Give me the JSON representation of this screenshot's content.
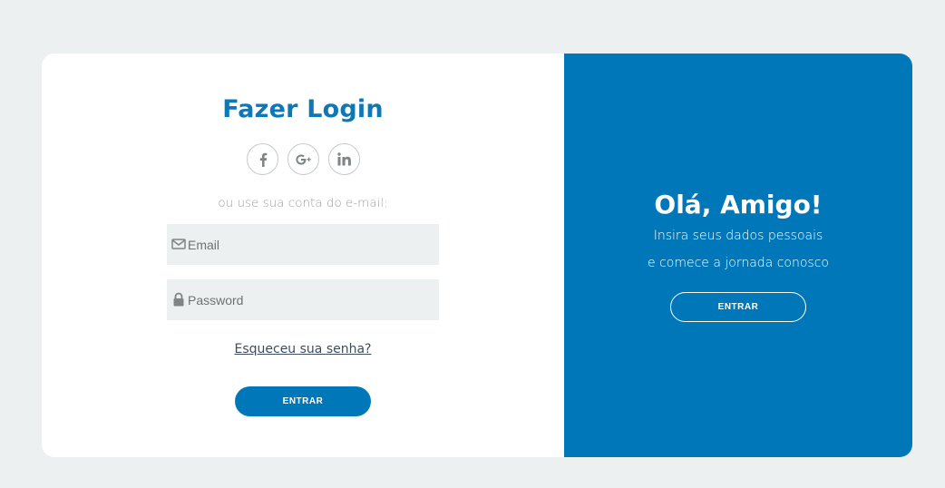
{
  "login": {
    "title": "Fazer Login",
    "social": [
      {
        "icon": "facebook-icon",
        "glyph": "f"
      },
      {
        "icon": "google-plus-icon",
        "glyph": "G+"
      },
      {
        "icon": "linkedin-icon",
        "glyph": "in"
      }
    ],
    "subtitle": "ou use sua conta do e-mail:",
    "email": {
      "value": "",
      "placeholder": "Email",
      "icon": "envelope-icon"
    },
    "password": {
      "value": "",
      "placeholder": "Password",
      "icon": "lock-icon"
    },
    "forgot_label": "Esqueceu sua senha?",
    "submit_label": "ENTRAR"
  },
  "welcome": {
    "title": "Olá, Amigo!",
    "line1": "Insira seus dados pessoais",
    "line2": "e comece a jornada conosco",
    "button_label": "ENTRAR"
  },
  "colors": {
    "background": "#ecf0f1",
    "primary": "#0077b9",
    "title": "#0e77b6",
    "field_bg": "#ecf0f1"
  }
}
